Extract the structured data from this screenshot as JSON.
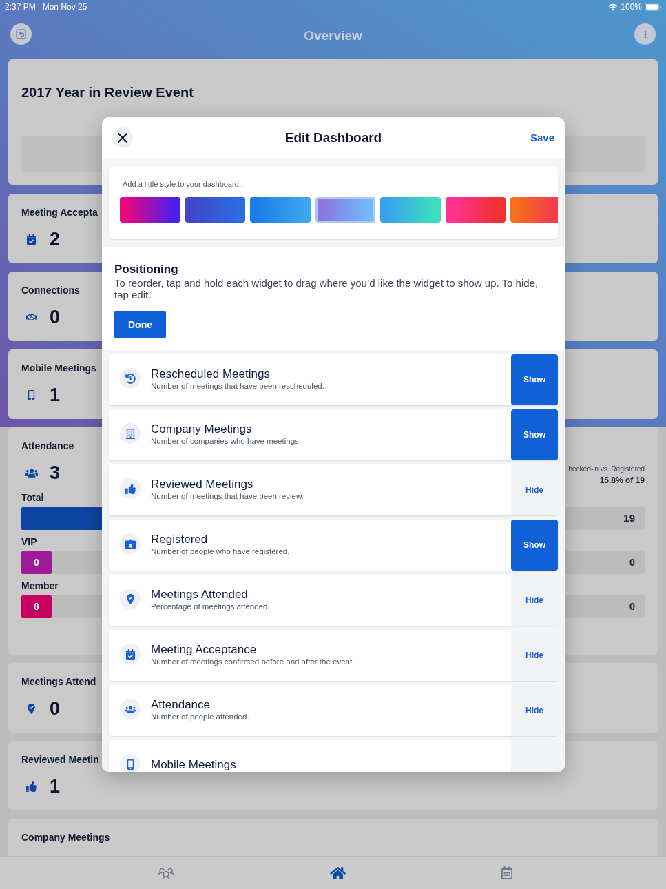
{
  "status_bar": {
    "time": "2:37 PM",
    "date": "Mon Nov 25",
    "battery": "100%"
  },
  "header": {
    "title": "Overview"
  },
  "event": {
    "title": "2017 Year in Review Event"
  },
  "stat_cards": [
    {
      "title": "Meeting Accepta",
      "value": "2"
    },
    {
      "title": "Connections",
      "value": "0"
    },
    {
      "title": "Mobile Meetings",
      "value": "1"
    }
  ],
  "attendance": {
    "title": "Attendance",
    "value": "3",
    "caption": "hecked-in vs. Registered",
    "summary": "15.8% of 19",
    "bars": [
      {
        "label": "Total",
        "level": 0.158,
        "total": "19",
        "color": "#0e44a4"
      },
      {
        "label": "VIP",
        "level": 0,
        "count": "0",
        "total": "0",
        "color": "#9d1a99"
      },
      {
        "label": "Member",
        "level": 0,
        "count": "0",
        "total": "0",
        "color": "#c80063"
      }
    ]
  },
  "lower_cards": [
    {
      "title": "Meetings Attend",
      "value": "0"
    },
    {
      "title": "Reviewed Meetin",
      "value": "1"
    },
    {
      "title": "Company Meetings"
    }
  ],
  "tab_bar": [
    {
      "selected": false
    },
    {
      "selected": true
    },
    {
      "selected": false
    }
  ],
  "modal": {
    "title": "Edit Dashboard",
    "save_label": "Save",
    "style_card": {
      "prompt": "Add a little style to your dashboard...",
      "swatches": [
        {
          "selected": false,
          "stops": [
            {
              "color": "#e8067e"
            },
            {
              "color": "#4a1ff0"
            }
          ]
        },
        {
          "selected": false,
          "stops": [
            {
              "color": "#3f47c6"
            },
            {
              "color": "#2c6ee2"
            }
          ]
        },
        {
          "selected": false,
          "stops": [
            {
              "color": "#1a7de6"
            },
            {
              "color": "#3ca6ee"
            }
          ]
        },
        {
          "selected": true,
          "stops": [
            {
              "color": "#8a79df"
            },
            {
              "color": "#72b9fb"
            }
          ]
        },
        {
          "selected": false,
          "stops": [
            {
              "color": "#37a2ee"
            },
            {
              "color": "#3ddfbf"
            }
          ]
        },
        {
          "selected": false,
          "stops": [
            {
              "color": "#ff3293"
            },
            {
              "color": "#f2302f"
            }
          ]
        },
        {
          "selected": false,
          "stops": [
            {
              "color": "#f8701a"
            },
            {
              "color": "#f23c4e"
            }
          ]
        }
      ]
    },
    "positioning": {
      "title": "Positioning",
      "description": "To reorder, tap and hold each widget to drag where you’d like the widget to show up. To hide, tap edit.",
      "button": "Done"
    },
    "widgets": [
      {
        "title": "Rescheduled Meetings",
        "description": "Number of meetings that have been rescheduled.",
        "hidden": true,
        "action": "Show"
      },
      {
        "title": "Company Meetings",
        "description": "Number of companies who have meetings.",
        "hidden": true,
        "action": "Show"
      },
      {
        "title": "Reviewed Meetings",
        "description": "Number of meetings that have been review.",
        "hidden": false,
        "action": "Hide"
      },
      {
        "title": "Registered",
        "description": "Number of people who have registered.",
        "hidden": true,
        "action": "Show"
      },
      {
        "title": "Meetings Attended",
        "description": "Percentage of meetings attended.",
        "hidden": false,
        "action": "Hide"
      },
      {
        "title": "Meeting Acceptance",
        "description": "Number of meetings confirmed before and after the event.",
        "hidden": false,
        "action": "Hide"
      },
      {
        "title": "Attendance",
        "description": "Number of people attended.",
        "hidden": false,
        "action": "Hide"
      },
      {
        "title": "Mobile Meetings",
        "hidden": false
      }
    ]
  }
}
